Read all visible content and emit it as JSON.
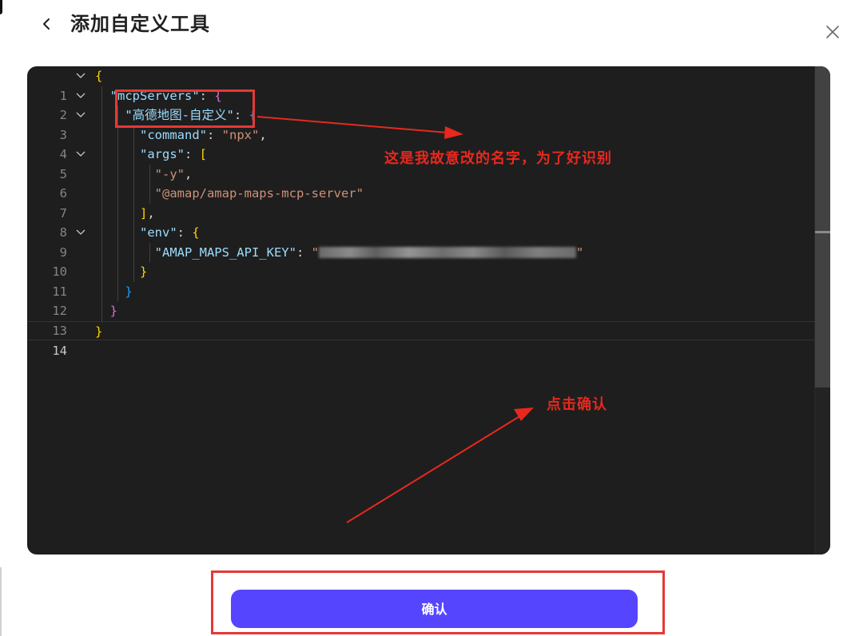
{
  "dialog": {
    "title": "添加自定义工具",
    "back_icon": "chevron-left-icon",
    "close_icon": "close-icon"
  },
  "editor": {
    "current_line": 14,
    "lines": [
      {
        "n": "1"
      },
      {
        "n": "2"
      },
      {
        "n": "3"
      },
      {
        "n": "4"
      },
      {
        "n": "5"
      },
      {
        "n": "6"
      },
      {
        "n": "7"
      },
      {
        "n": "8"
      },
      {
        "n": "9"
      },
      {
        "n": "10"
      },
      {
        "n": "11"
      },
      {
        "n": "12"
      },
      {
        "n": "13"
      },
      {
        "n": "14"
      }
    ],
    "tokens": {
      "mcpServers": "\"mcpServers\"",
      "server_name": "\"高德地图-自定义\"",
      "command_key": "\"command\"",
      "command_val": "\"npx\"",
      "args_key": "\"args\"",
      "arg1": "\"-y\"",
      "arg2": "\"@amap/amap-maps-mcp-server\"",
      "env_key": "\"env\"",
      "api_key_name": "\"AMAP_MAPS_API_KEY\"",
      "api_key_open_quote": "\"",
      "api_key_close_quote": "\"",
      "open_brace": "{",
      "close_brace": "}",
      "open_bracket": "[",
      "close_bracket": "]",
      "colon": ": ",
      "comma": ","
    }
  },
  "annotations": {
    "name_note": "这是我故意改的名字，为了好识别",
    "click_note": "点击确认",
    "color": "#e8281e"
  },
  "footer": {
    "confirm_label": "确认",
    "confirm_color": "#5645ff"
  }
}
